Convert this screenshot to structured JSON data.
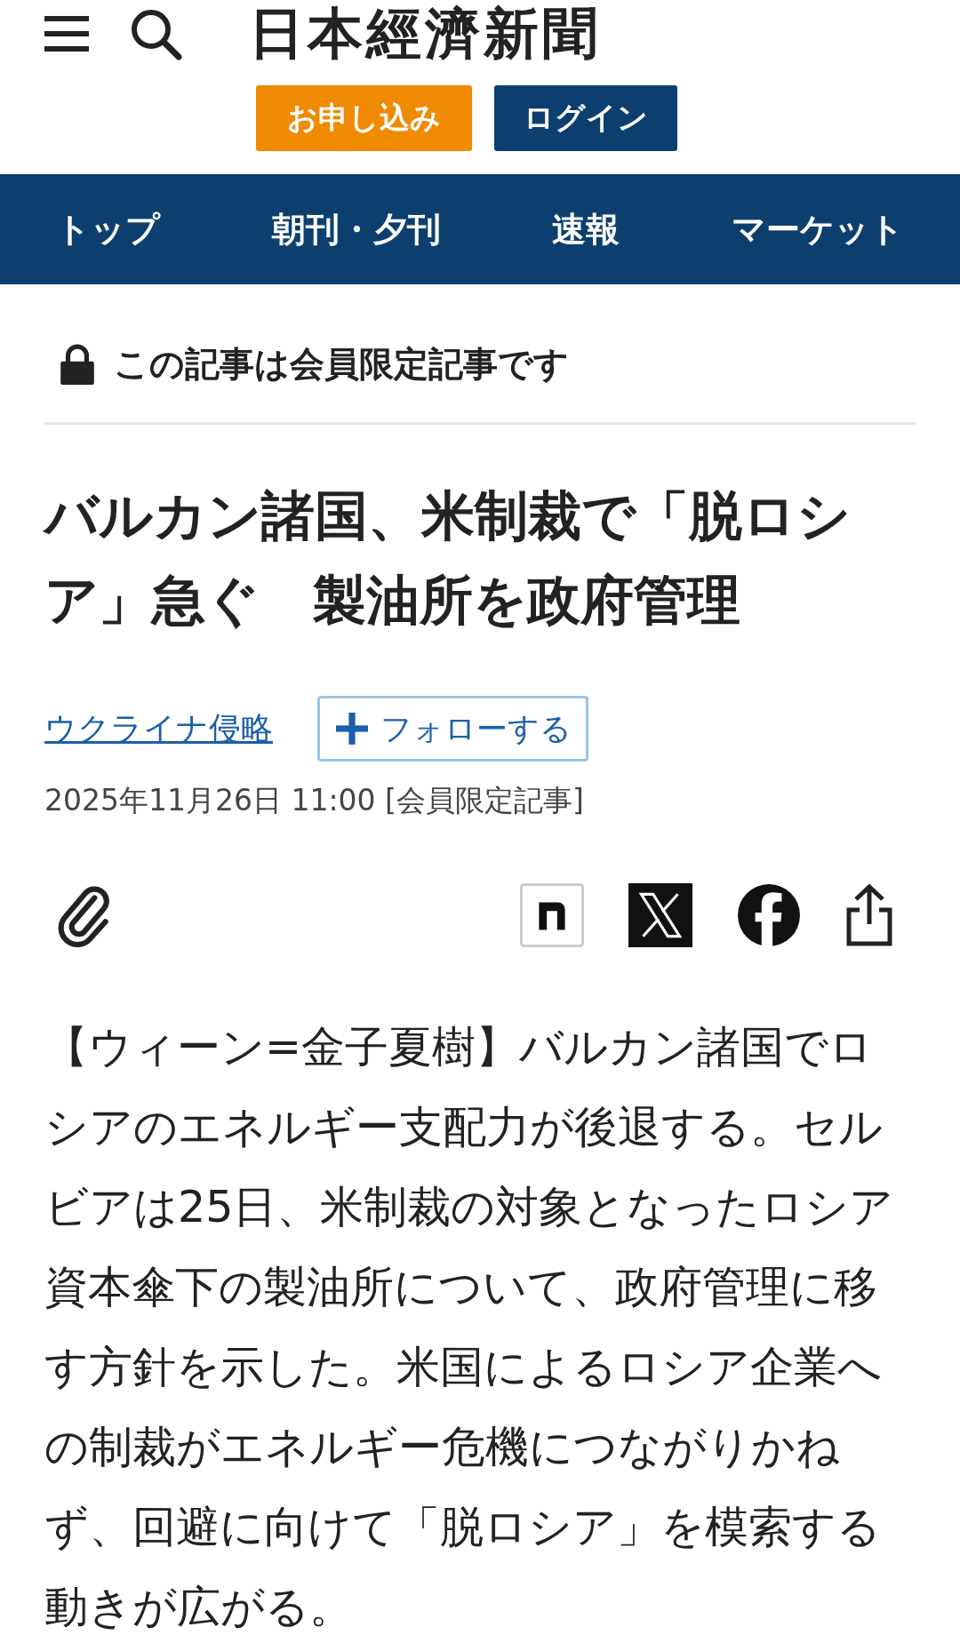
{
  "header": {
    "logo": "日本經濟新聞",
    "buttons": [
      {
        "label": "お申し込み",
        "kind": "primary"
      },
      {
        "label": "ログイン",
        "kind": "secondary"
      }
    ]
  },
  "nav": [
    {
      "label": "トップ"
    },
    {
      "label": "朝刊・夕刊"
    },
    {
      "label": "速報"
    },
    {
      "label": "マーケット"
    }
  ],
  "notice": "この記事は会員限定記事です",
  "headline": "バルカン諸国、米制裁で「脱ロシア」急ぐ　製油所を政府管理",
  "topic": {
    "link": "ウクライナ侵略",
    "follow": "フォローする"
  },
  "dateline": "2025年11月26日 11:00 [会員限定記事]",
  "body": "【ウィーン=金子夏樹】バルカン諸国でロシアのエネルギー支配力が後退する。セルビアは25日、米制裁の対象となったロシア資本傘下の製油所について、政府管理に移す方針を示した。米国によるロシア企業への制裁がエネルギー危機につながりかねず、回避に向けて「脱ロシア」を模索する動きが広がる。"
}
